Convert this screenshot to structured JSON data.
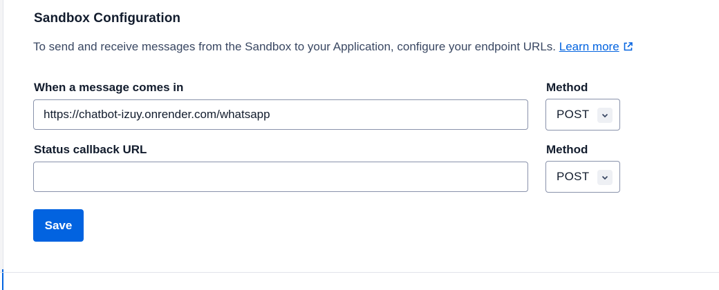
{
  "section": {
    "title": "Sandbox Configuration",
    "description": "To send and receive messages from the Sandbox to your Application, configure your endpoint URLs.",
    "learn_more": "Learn more"
  },
  "incoming": {
    "label": "When a message comes in",
    "value": "https://chatbot-izuy.onrender.com/whatsapp",
    "method_label": "Method",
    "method_value": "POST"
  },
  "status_callback": {
    "label": "Status callback URL",
    "value": "",
    "method_label": "Method",
    "method_value": "POST"
  },
  "actions": {
    "save_label": "Save"
  },
  "colors": {
    "primary": "#0263e0",
    "text": "#121c2d",
    "border": "#8891aa"
  },
  "icons": {
    "external_link": "external-link-icon",
    "chevron": "chevron-down-icon"
  }
}
